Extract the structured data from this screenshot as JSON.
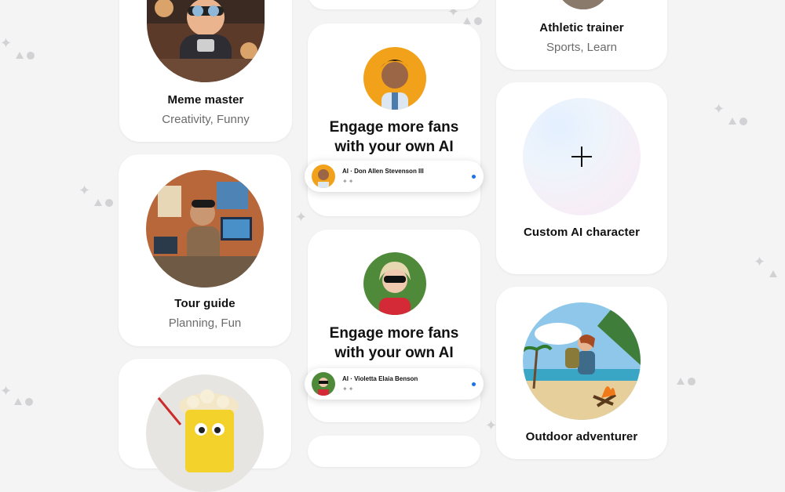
{
  "column_left": {
    "card1": {
      "title": "Meme master",
      "subtitle": "Creativity, Funny"
    },
    "card2": {
      "title": "Tour guide",
      "subtitle": "Planning, Fun"
    }
  },
  "column_middle": {
    "promo1": {
      "line1": "Engage more fans",
      "line2": "with your own AI",
      "chip_name": "AI · Don Allen Stevenson III"
    },
    "promo2": {
      "line1": "Engage more fans",
      "line2": "with your own AI",
      "chip_name": "AI · Violetta Elaia Benson"
    }
  },
  "column_right": {
    "card1": {
      "title": "Athletic trainer",
      "subtitle": "Sports, Learn"
    },
    "card2": {
      "title": "Custom AI character"
    },
    "card3": {
      "title": "Outdoor adventurer"
    }
  },
  "icons": {
    "plus": "plus-icon",
    "sparkle": "sparkle-icon"
  },
  "colors": {
    "background": "#f4f4f5",
    "card": "#ffffff",
    "accent_dot": "#1a73e8",
    "subtitle": "#6b6b6b"
  }
}
